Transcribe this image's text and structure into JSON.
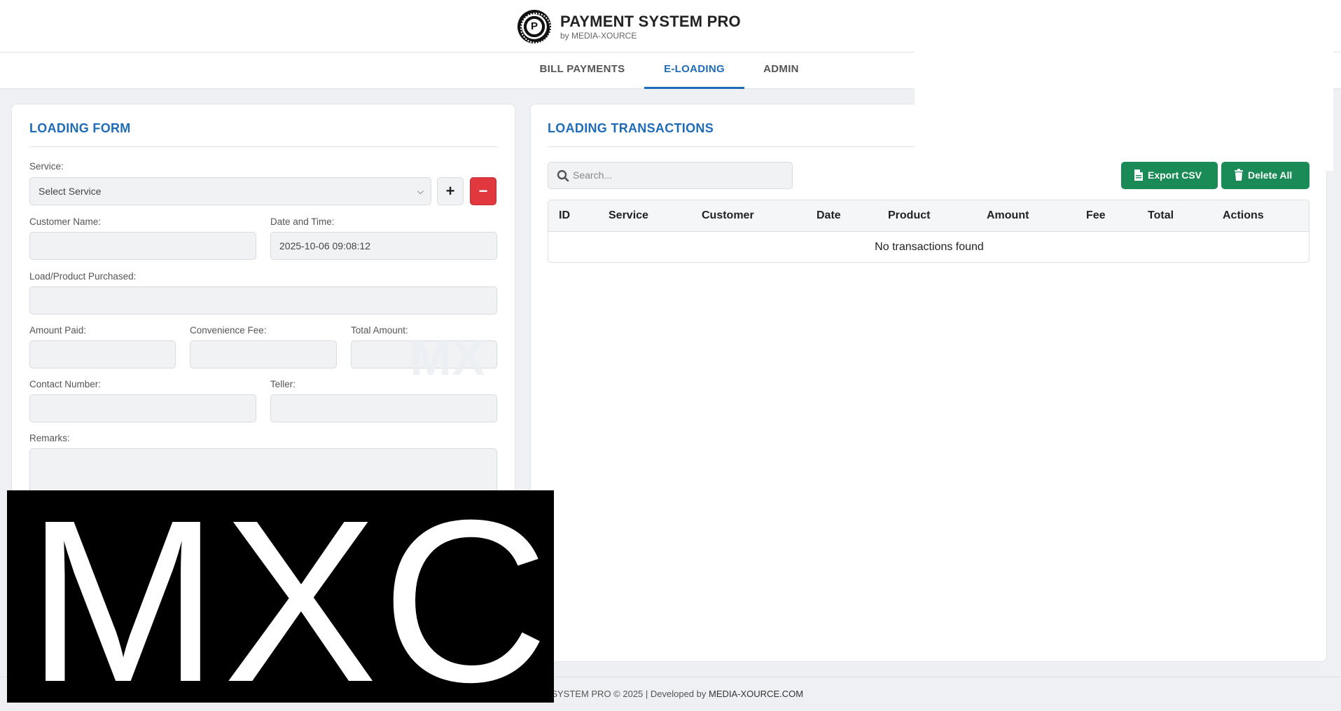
{
  "header": {
    "logo_letter": "P",
    "title": "PAYMENT SYSTEM PRO",
    "subtitle": "by MEDIA-XOURCE"
  },
  "nav": {
    "tabs": [
      {
        "label": "BILL PAYMENTS",
        "active": false
      },
      {
        "label": "E-LOADING",
        "active": true
      },
      {
        "label": "ADMIN",
        "active": false
      }
    ]
  },
  "form": {
    "title": "LOADING FORM",
    "service_label": "Service:",
    "service_value": "Select Service",
    "add_label": "+",
    "remove_label": "−",
    "customer_label": "Customer Name:",
    "customer_value": "",
    "datetime_label": "Date and Time:",
    "datetime_value": "2025-10-06 09:08:12",
    "product_label": "Load/Product Purchased:",
    "product_value": "",
    "amount_label": "Amount Paid:",
    "amount_value": "",
    "fee_label": "Convenience Fee:",
    "fee_value": "",
    "total_label": "Total Amount:",
    "total_value": "",
    "contact_label": "Contact Number:",
    "contact_value": "",
    "teller_label": "Teller:",
    "teller_value": "",
    "remarks_label": "Remarks:",
    "remarks_value": ""
  },
  "transactions": {
    "title": "LOADING TRANSACTIONS",
    "search_placeholder": "Search...",
    "export_label": "Export CSV",
    "delete_all_label": "Delete All",
    "columns": [
      "ID",
      "Service",
      "Customer",
      "Date",
      "Product",
      "Amount",
      "Fee",
      "Total",
      "Actions"
    ],
    "empty_message": "No transactions found"
  },
  "watermark": "MX",
  "overlay": {
    "text": "MXC"
  },
  "footer": {
    "text": "T SYSTEM PRO © 2025 | Developed by ",
    "link": "MEDIA-XOURCE.COM"
  },
  "colors": {
    "accent": "#1e6bb8",
    "success": "#1a8a57",
    "danger": "#e0383e"
  }
}
